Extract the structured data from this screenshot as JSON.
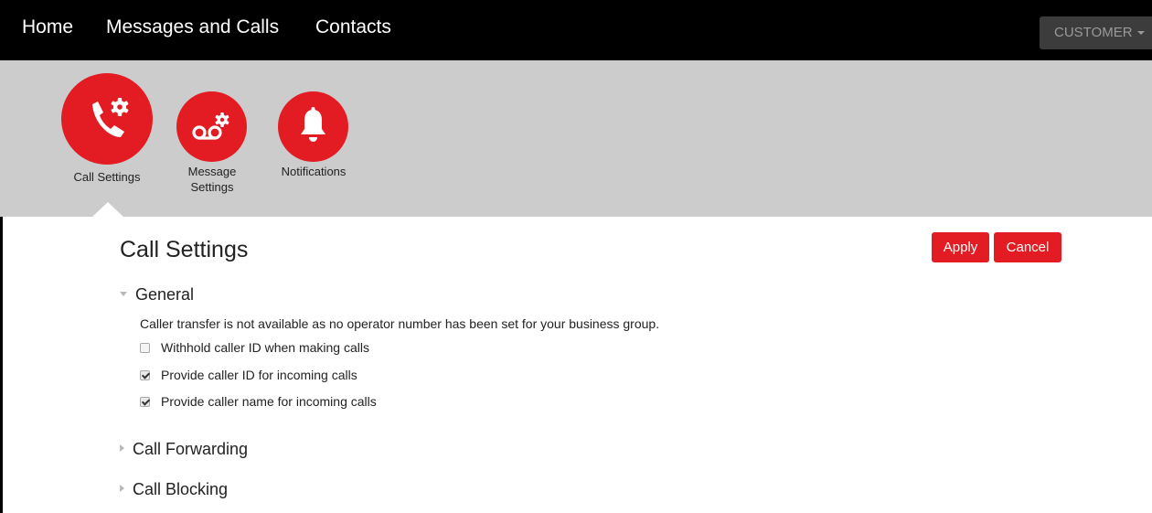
{
  "topnav": {
    "items": [
      "Home",
      "Messages and Calls",
      "Contacts"
    ],
    "account_label": "CUSTOMER"
  },
  "settings_tiles": [
    {
      "label": "Call Settings",
      "icon": "phone-gear-icon",
      "active": true
    },
    {
      "label": "Message Settings",
      "icon": "voicemail-gear-icon",
      "active": false
    },
    {
      "label": "Notifications",
      "icon": "bell-icon",
      "active": false
    }
  ],
  "page": {
    "title": "Call Settings",
    "apply_label": "Apply",
    "cancel_label": "Cancel"
  },
  "general": {
    "title": "General",
    "expanded": true,
    "info": "Caller transfer is not available as no operator number has been set for your business group.",
    "options": [
      {
        "label": "Withhold caller ID when making calls",
        "checked": false
      },
      {
        "label": "Provide caller ID for incoming calls",
        "checked": true
      },
      {
        "label": "Provide caller name for incoming calls",
        "checked": true
      }
    ]
  },
  "sections": [
    {
      "title": "Call Forwarding",
      "expanded": false
    },
    {
      "title": "Call Blocking",
      "expanded": false
    }
  ],
  "colors": {
    "brand_red": "#e31b23",
    "topbar": "#000000",
    "iconbar": "#cccccc"
  }
}
